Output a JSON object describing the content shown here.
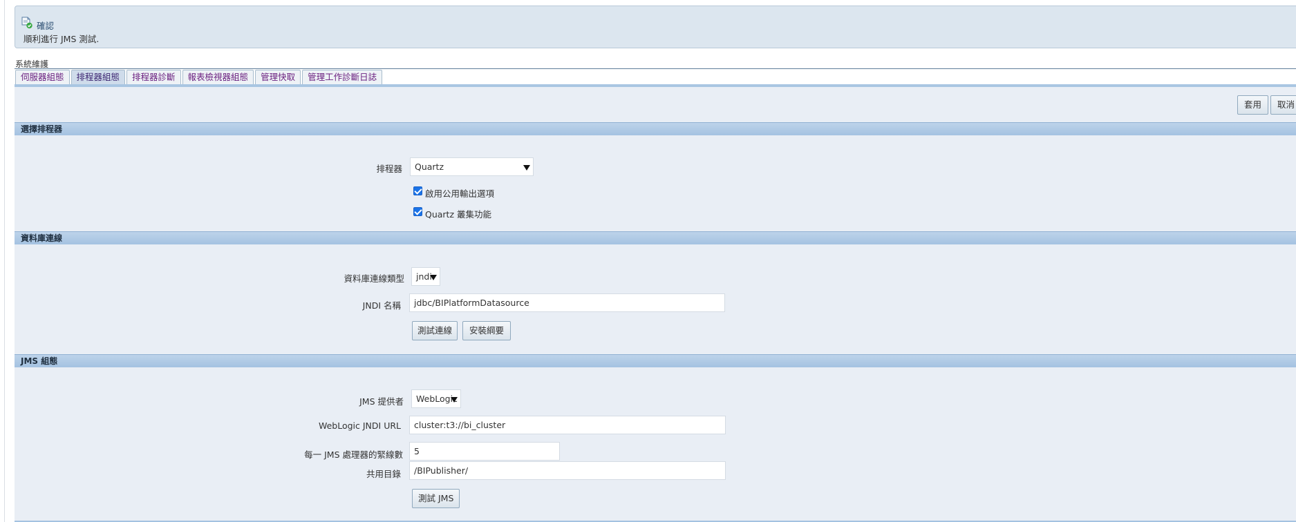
{
  "banner": {
    "title": "確認",
    "message": "順利進行 JMS 測試."
  },
  "breadcrumb": "系統維護",
  "tabs": [
    {
      "label": "伺服器組態",
      "active": false
    },
    {
      "label": "排程器組態",
      "active": true
    },
    {
      "label": "排程器診斷",
      "active": false
    },
    {
      "label": "報表檢視器組態",
      "active": false
    },
    {
      "label": "管理快取",
      "active": false
    },
    {
      "label": "管理工作診斷日誌",
      "active": false
    }
  ],
  "actions": {
    "apply": "套用",
    "cancel": "取消"
  },
  "scheduler_section": {
    "title": "選擇排程器",
    "scheduler_label": "排程器",
    "scheduler_value": "Quartz",
    "enable_public_output_label": "啟用公用輸出選項",
    "quartz_cluster_label": "Quartz 叢集功能",
    "enable_public_output_checked": true,
    "quartz_cluster_checked": true
  },
  "database_section": {
    "title": "資料庫連線",
    "connection_type_label": "資料庫連線類型",
    "connection_type_value": "jndi",
    "jndi_name_label": "JNDI 名稱",
    "jndi_name_value": "jdbc/BIPlatformDatasource",
    "test_connection_button": "測試連線",
    "install_schema_button": "安裝綱要"
  },
  "jms_section": {
    "title": "JMS 組態",
    "provider_label": "JMS 提供者",
    "provider_value": "WebLogic",
    "jndi_url_label": "WebLogic JNDI URL",
    "jndi_url_value": "cluster:t3://bi_cluster",
    "threads_label": "每一 JMS 處理器的緊線數",
    "threads_value": "5",
    "shared_dir_label": "共用目錄",
    "shared_dir_value": "/BIPublisher/",
    "test_jms_button": "測試 JMS"
  }
}
